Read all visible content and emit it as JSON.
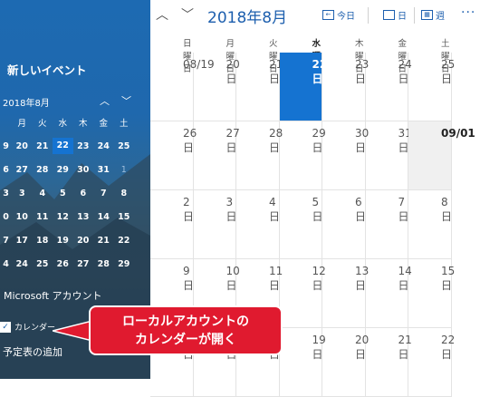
{
  "sidebar": {
    "new_event": "新しいイベント",
    "mini_month": "2018年8月",
    "mini_weekdays": [
      "月",
      "火",
      "水",
      "木",
      "金",
      "土"
    ],
    "mini_rows": [
      [
        "20",
        "21",
        "22",
        "23",
        "24",
        "25"
      ],
      [
        "27",
        "28",
        "29",
        "30",
        "31",
        "1"
      ],
      [
        "3",
        "4",
        "5",
        "6",
        "7",
        "8"
      ],
      [
        "10",
        "11",
        "12",
        "13",
        "14",
        "15"
      ],
      [
        "17",
        "18",
        "19",
        "20",
        "21",
        "22"
      ],
      [
        "24",
        "25",
        "26",
        "27",
        "28",
        "29"
      ]
    ],
    "mini_row_starts": [
      "9",
      "6",
      "3",
      "0",
      "7",
      "4"
    ],
    "account": "Microsoft アカウント",
    "calendar_label": "カレンダー",
    "calendar_checked": true,
    "add_calendar": "予定表の追加"
  },
  "toolbar": {
    "month_title": "2018年8月",
    "today_label": "今日",
    "day_label": "日",
    "week_label": "週"
  },
  "calendar": {
    "weekdays": [
      "日曜日",
      "月曜日",
      "火曜日",
      "水曜日",
      "木曜日",
      "金曜日",
      "土曜日"
    ],
    "weeks": [
      [
        "08/19",
        "20日",
        "21日",
        "22日",
        "23日",
        "24日",
        "25日"
      ],
      [
        "26日",
        "27日",
        "28日",
        "29日",
        "30日",
        "31日",
        "09/01"
      ],
      [
        "2日",
        "3日",
        "4日",
        "5日",
        "6日",
        "7日",
        "8日"
      ],
      [
        "9日",
        "10日",
        "11日",
        "12日",
        "13日",
        "14日",
        "15日"
      ],
      [
        "16日",
        "17日",
        "18日",
        "19日",
        "20日",
        "21日",
        "22日"
      ]
    ],
    "today": "22日"
  },
  "annotation": {
    "line1": "ローカルアカウントの",
    "line2": "カレンダーが開く"
  }
}
